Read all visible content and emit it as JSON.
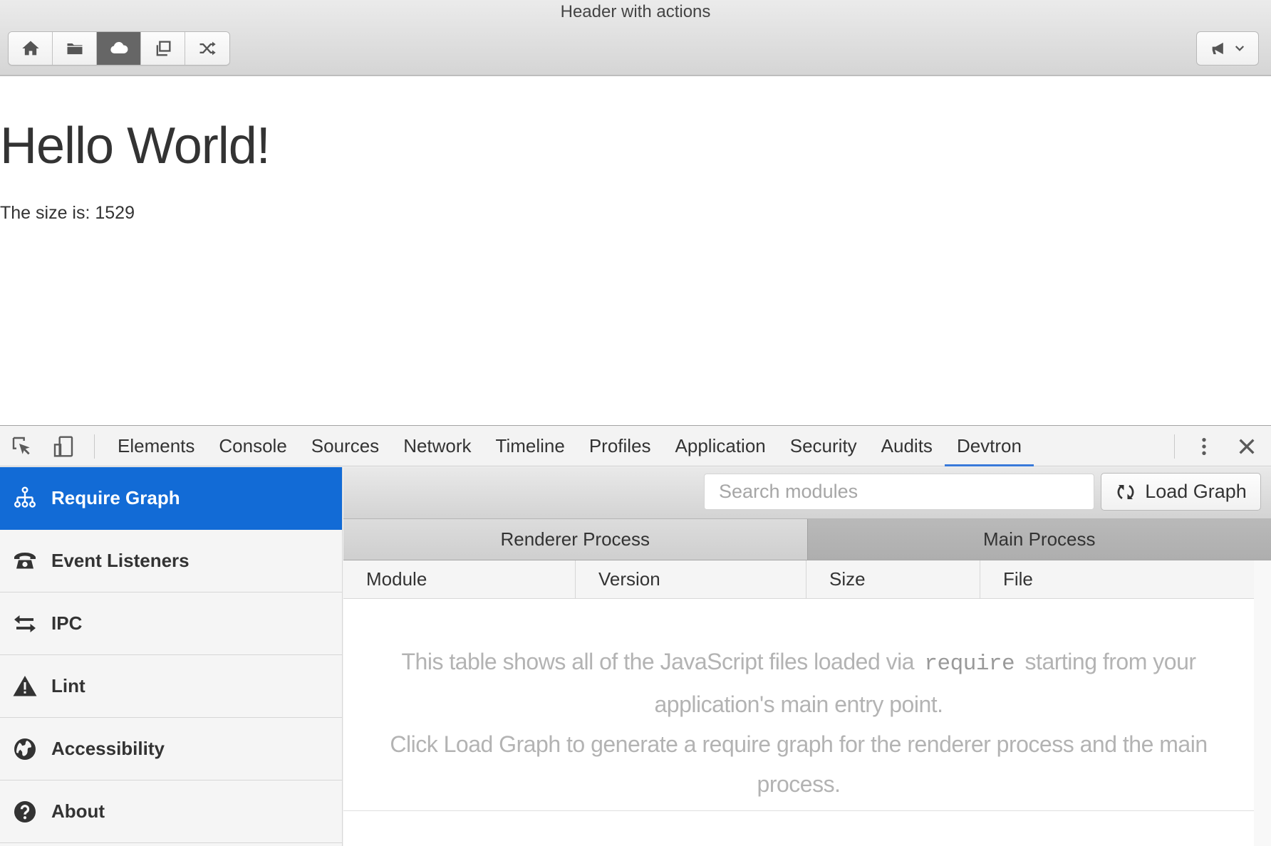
{
  "window": {
    "title": "Header with actions",
    "toolbar_buttons": [
      {
        "name": "home",
        "icon": "home-icon",
        "active": false
      },
      {
        "name": "folder",
        "icon": "folder-icon",
        "active": false
      },
      {
        "name": "cloud",
        "icon": "cloud-icon",
        "active": true
      },
      {
        "name": "popup",
        "icon": "popup-icon",
        "active": false
      },
      {
        "name": "shuffle",
        "icon": "shuffle-icon",
        "active": false
      }
    ],
    "dropdown_icon": "megaphone-icon"
  },
  "page": {
    "heading": "Hello World!",
    "size_text": "The size is: 1529"
  },
  "devtools": {
    "tabs": [
      {
        "label": "Elements"
      },
      {
        "label": "Console"
      },
      {
        "label": "Sources"
      },
      {
        "label": "Network"
      },
      {
        "label": "Timeline"
      },
      {
        "label": "Profiles"
      },
      {
        "label": "Application"
      },
      {
        "label": "Security"
      },
      {
        "label": "Audits"
      },
      {
        "label": "Devtron"
      }
    ],
    "active_tab": "Devtron",
    "accent_color": "#3879d9",
    "sidebar": {
      "items": [
        {
          "label": "Require Graph",
          "icon": "sitemap-icon",
          "active": true
        },
        {
          "label": "Event Listeners",
          "icon": "phone-icon",
          "active": false
        },
        {
          "label": "IPC",
          "icon": "exchange-icon",
          "active": false
        },
        {
          "label": "Lint",
          "icon": "warning-icon",
          "active": false
        },
        {
          "label": "Accessibility",
          "icon": "globe-icon",
          "active": false
        },
        {
          "label": "About",
          "icon": "question-icon",
          "active": false
        }
      ],
      "active_color": "#126bd6"
    },
    "main": {
      "search_placeholder": "Search modules",
      "search_value": "",
      "load_button_label": "Load Graph",
      "process_tabs": [
        {
          "label": "Renderer Process",
          "selected": false
        },
        {
          "label": "Main Process",
          "selected": true
        }
      ],
      "columns": [
        "Module",
        "Version",
        "Size",
        "File"
      ],
      "empty_message": {
        "line1_before": "This table shows all of the JavaScript files loaded via",
        "line1_code": "require",
        "line1_after": "starting from your application's main entry point.",
        "line2": "Click Load Graph to generate a require graph for the renderer process and the main process."
      }
    }
  }
}
